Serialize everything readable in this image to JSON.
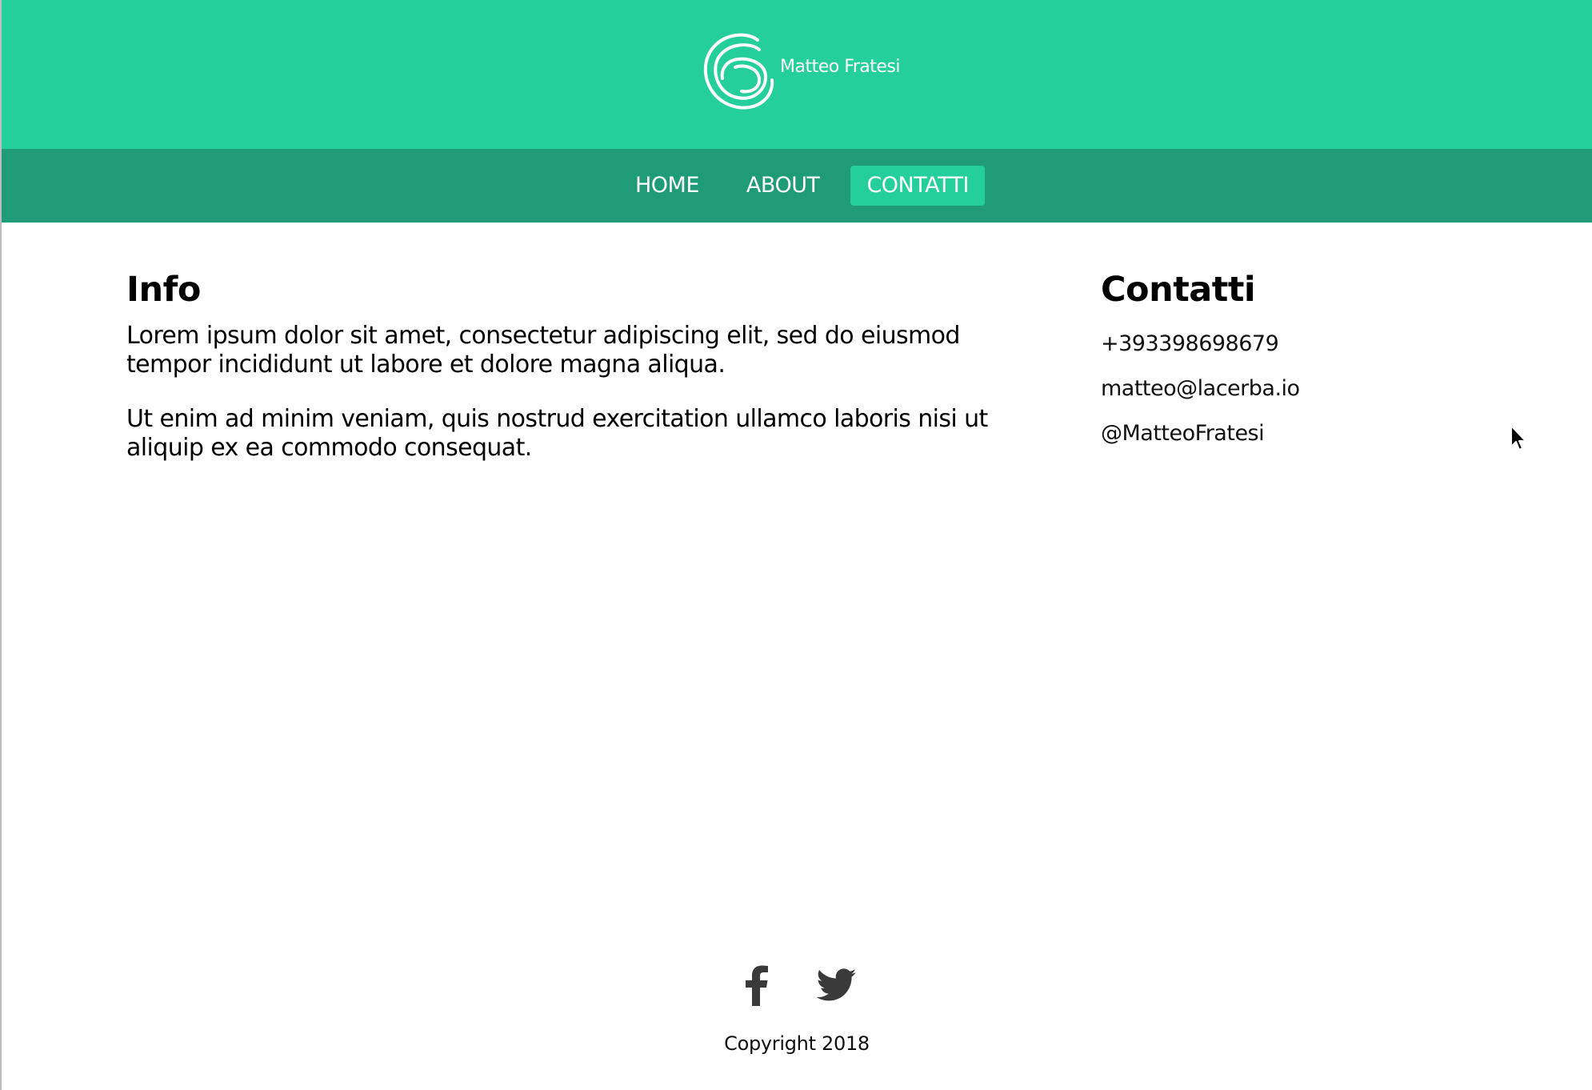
{
  "header": {
    "brand_name": "Matteo Fratesi",
    "logo_icon": "spiral-circle-logo",
    "background_color": "#24cf9b"
  },
  "nav": {
    "background_color": "#1f9b77",
    "items": [
      {
        "label": "HOME",
        "active": false
      },
      {
        "label": "ABOUT",
        "active": false
      },
      {
        "label": "CONTATTI",
        "active": true
      }
    ]
  },
  "info": {
    "title": "Info",
    "paragraphs": [
      "Lorem ipsum dolor sit amet, consectetur adipiscing elit, sed do eiusmod tempor incididunt ut labore et dolore magna aliqua.",
      "Ut enim ad minim veniam, quis nostrud exercitation ullamco laboris nisi ut aliquip ex ea commodo consequat."
    ]
  },
  "contacts": {
    "title": "Contatti",
    "phone": "+393398698679",
    "email": "matteo@lacerba.io",
    "twitter": "@MatteoFratesi"
  },
  "footer": {
    "social_icons": [
      "facebook-icon",
      "twitter-icon"
    ],
    "copyright": "Copyright 2018"
  }
}
